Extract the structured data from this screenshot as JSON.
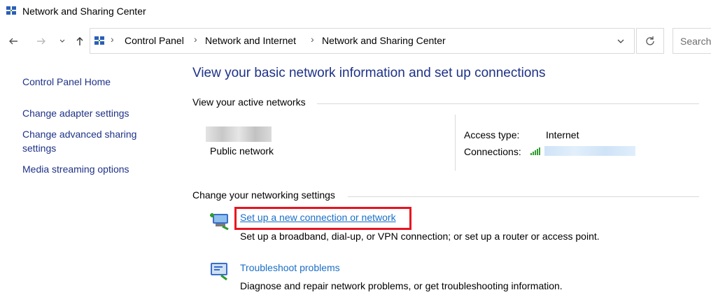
{
  "window": {
    "title": "Network and Sharing Center"
  },
  "addressbar": {
    "crumbs": [
      "Control Panel",
      "Network and Internet",
      "Network and Sharing Center"
    ],
    "search_placeholder": "Search"
  },
  "sidebar": {
    "items": [
      {
        "label": "Control Panel Home"
      },
      {
        "label": "Change adapter settings"
      },
      {
        "label": "Change advanced sharing",
        "label2": "settings"
      },
      {
        "label": "Media streaming options"
      }
    ]
  },
  "main": {
    "title": "View your basic network information and set up connections",
    "active_networks_heading": "View your active networks",
    "network": {
      "type": "Public network",
      "access_type_label": "Access type:",
      "access_type_value": "Internet",
      "connections_label": "Connections:"
    },
    "change_settings_heading": "Change your networking settings",
    "tasks": [
      {
        "link": "Set up a new connection or network",
        "desc": "Set up a broadband, dial-up, or VPN connection; or set up a router or access point."
      },
      {
        "link": "Troubleshoot problems",
        "desc": "Diagnose and repair network problems, or get troubleshooting information."
      }
    ]
  },
  "colors": {
    "link": "#1a6fc7",
    "nav_link": "#1e3287",
    "highlight": "#e8141f"
  }
}
